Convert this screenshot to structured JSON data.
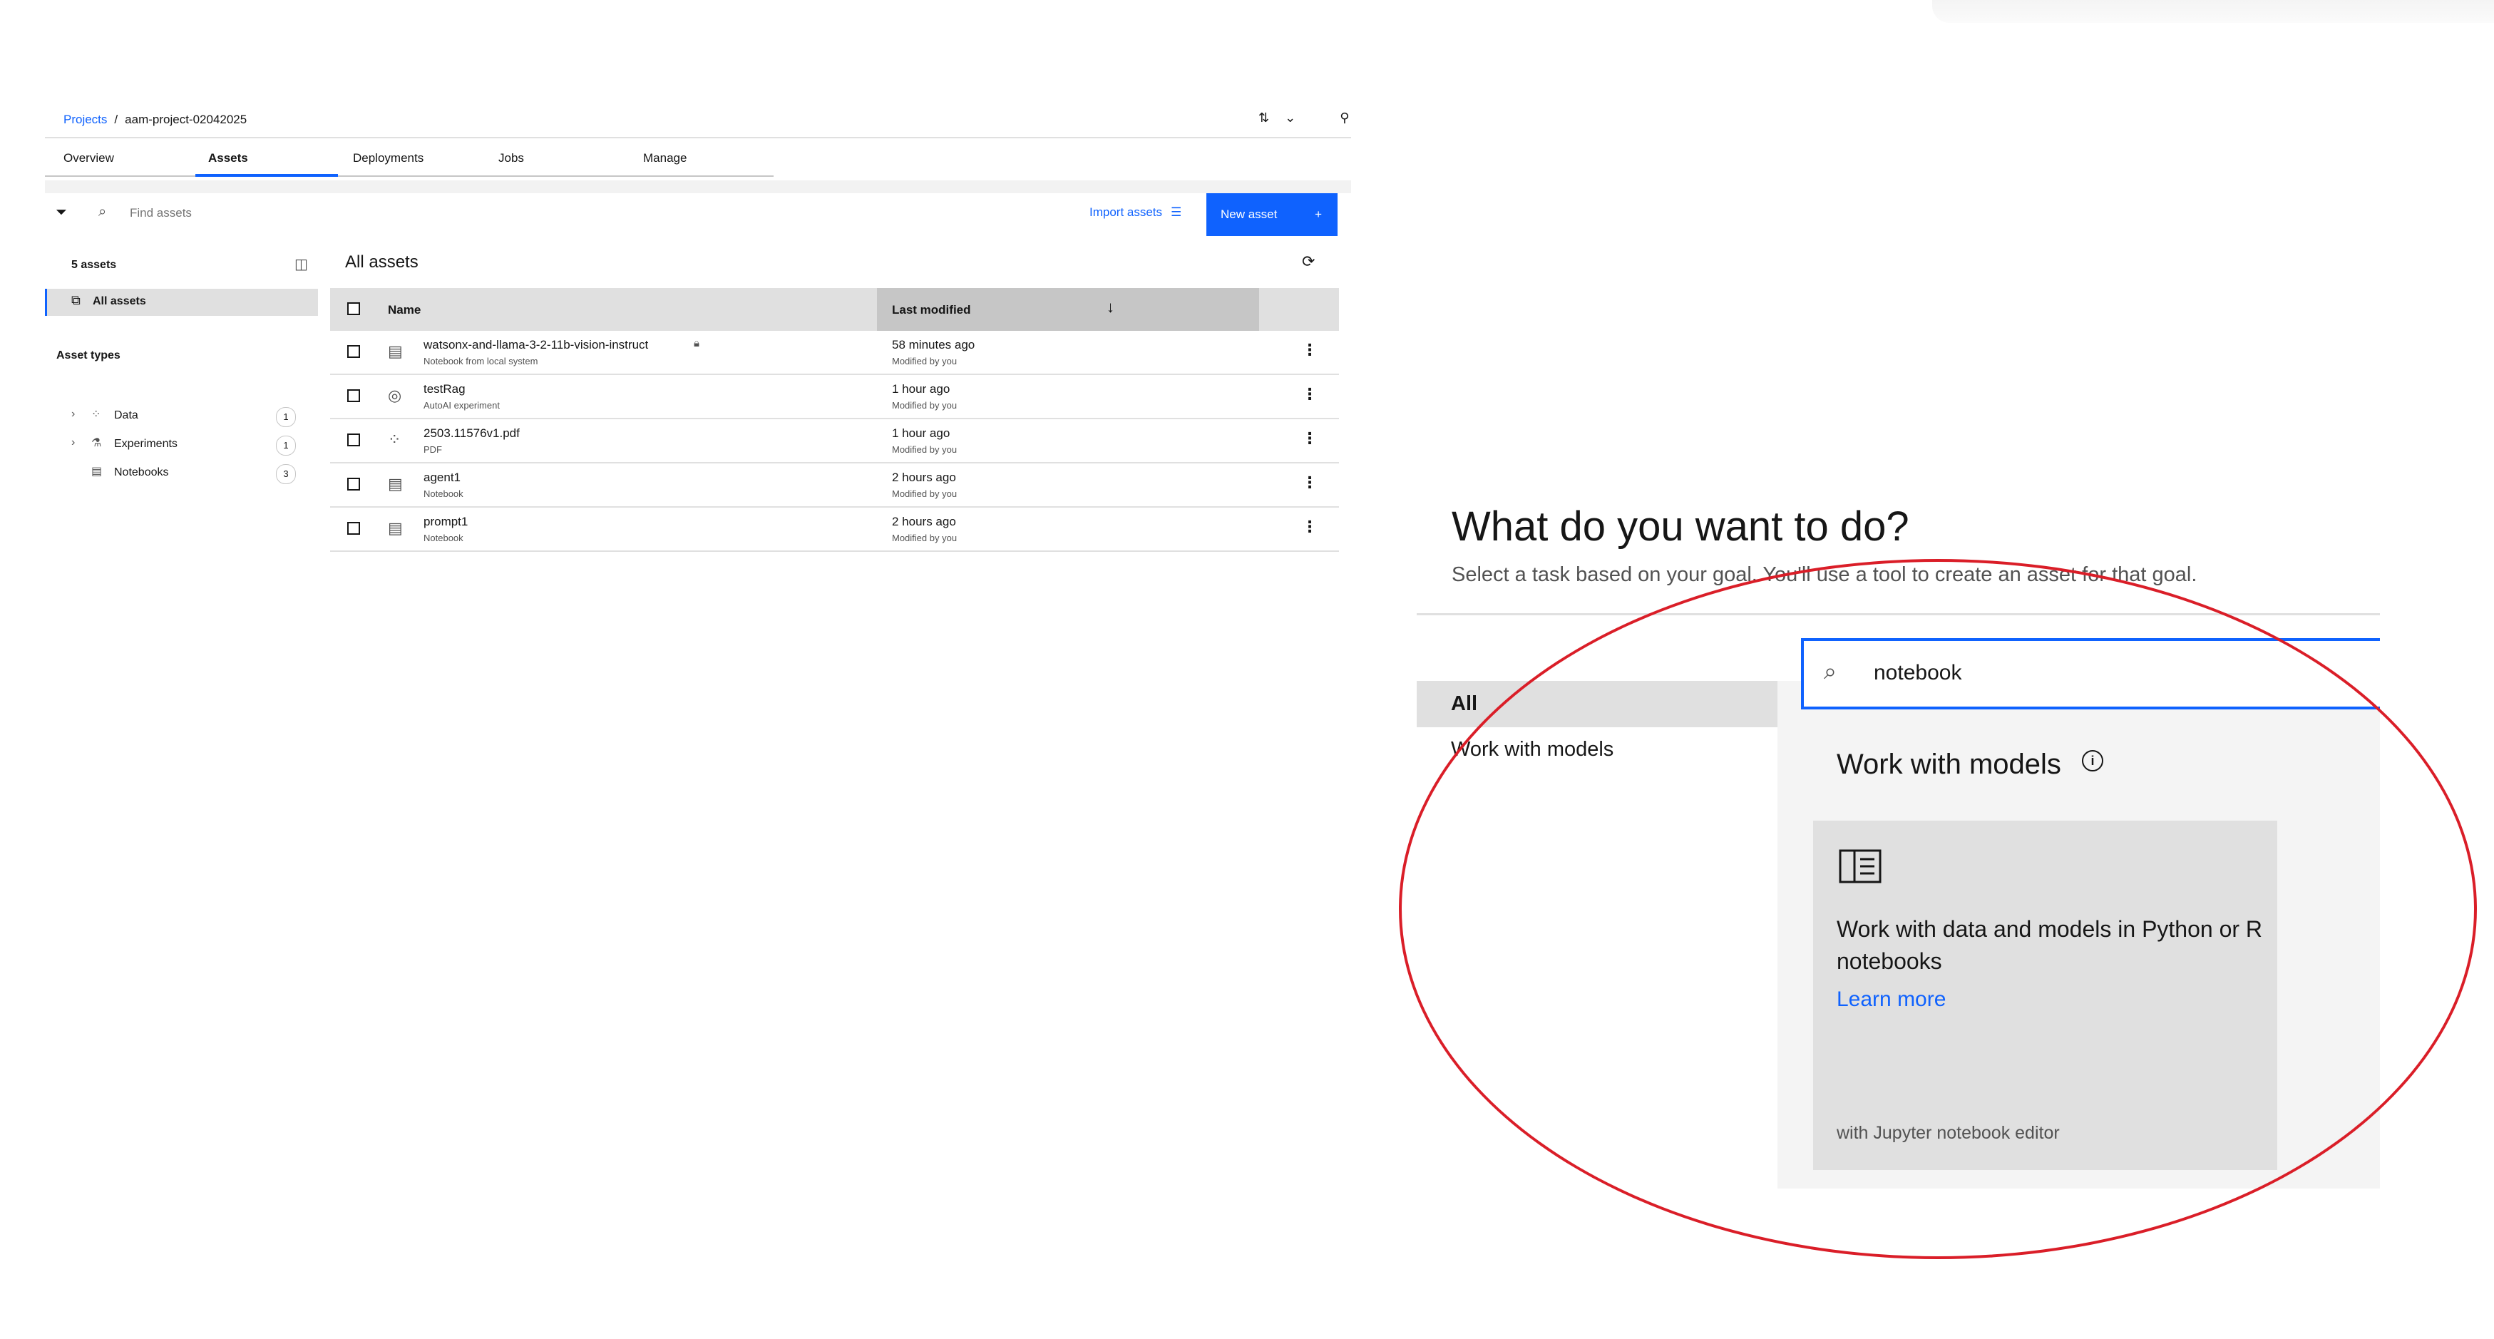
{
  "breadcrumb": {
    "root": "Projects",
    "separator": "/",
    "current": "aam-project-02042025"
  },
  "header_icons": [
    "transfer-icon",
    "chevron-down-icon",
    "pin-icon"
  ],
  "tabs": [
    {
      "label": "Overview",
      "active": false
    },
    {
      "label": "Assets",
      "active": true
    },
    {
      "label": "Deployments",
      "active": false
    },
    {
      "label": "Jobs",
      "active": false
    },
    {
      "label": "Manage",
      "active": false
    }
  ],
  "toolbar": {
    "search_placeholder": "Find assets",
    "import_label": "Import assets",
    "new_asset_label": "New asset",
    "new_asset_icon": "+"
  },
  "sidebar": {
    "asset_count": "5 assets",
    "all_assets": "All assets",
    "asset_types_heading": "Asset types",
    "types": [
      {
        "label": "Data",
        "count": "1",
        "expandable": true
      },
      {
        "label": "Experiments",
        "count": "1",
        "expandable": true
      },
      {
        "label": "Notebooks",
        "count": "3",
        "expandable": false
      }
    ]
  },
  "table": {
    "title": "All assets",
    "columns": {
      "name": "Name",
      "last_modified": "Last modified"
    },
    "rows": [
      {
        "name": "watsonx-and-llama-3-2-11b-vision-instruct",
        "subtitle": "Notebook from local system",
        "modified": "58 minutes ago",
        "modified_by": "Modified by you",
        "icon": "notebook-icon",
        "locked": true
      },
      {
        "name": "testRag",
        "subtitle": "AutoAI experiment",
        "modified": "1 hour ago",
        "modified_by": "Modified by you",
        "icon": "experiment-icon",
        "locked": false
      },
      {
        "name": "2503.11576v1.pdf",
        "subtitle": "PDF",
        "modified": "1 hour ago",
        "modified_by": "Modified by you",
        "icon": "data-icon",
        "locked": false
      },
      {
        "name": "agent1",
        "subtitle": "Notebook",
        "modified": "2 hours ago",
        "modified_by": "Modified by you",
        "icon": "notebook-icon",
        "locked": false
      },
      {
        "name": "prompt1",
        "subtitle": "Notebook",
        "modified": "2 hours ago",
        "modified_by": "Modified by you",
        "icon": "notebook-icon",
        "locked": false
      }
    ]
  },
  "task_dialog": {
    "title": "What do you want to do?",
    "subtitle": "Select a task based on your goal. You'll use a tool to create an asset for that goal.",
    "categories": [
      "All",
      "Work with models"
    ],
    "search_value": "notebook",
    "section_title": "Work with models",
    "tile": {
      "description": "Work with data and models in Python or R notebooks",
      "learn_more": "Learn more",
      "footer": "with Jupyter notebook editor"
    }
  },
  "colors": {
    "accent": "#0f62fe",
    "annotation": "#da1e28"
  }
}
